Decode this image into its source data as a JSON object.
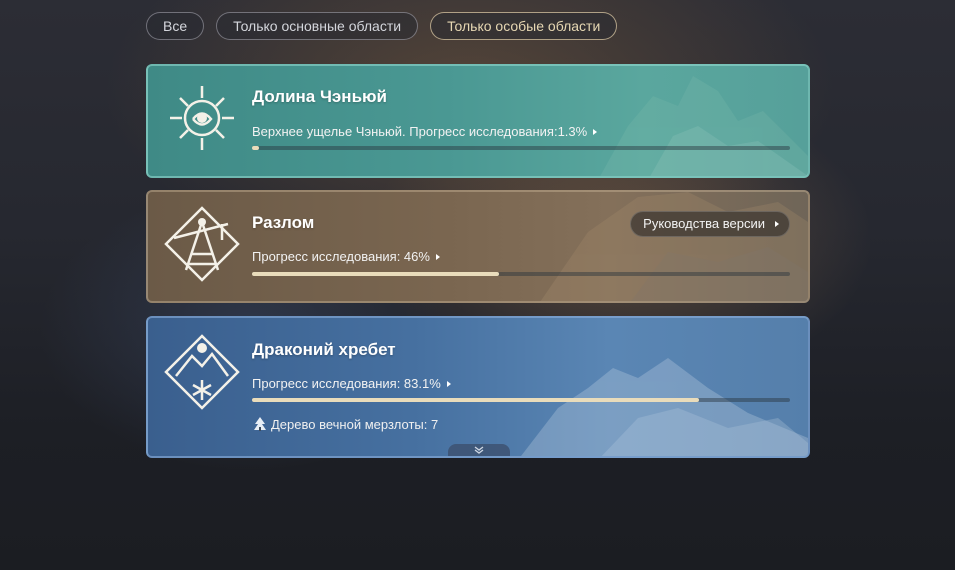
{
  "filters": [
    {
      "label": "Все",
      "active": false
    },
    {
      "label": "Только основные области",
      "active": false
    },
    {
      "label": "Только особые области",
      "active": true
    }
  ],
  "regions": [
    {
      "name": "Долина Чэньюй",
      "progress_label": "Верхнее ущелье Чэньюй. Прогресс исследования:1.3%",
      "progress": 1.3,
      "icon": "chenyu-vale-emblem-icon"
    },
    {
      "name": "Разлом",
      "progress_label": "Прогресс исследования: 46%",
      "progress": 46,
      "guide_button": "Руководства версии",
      "icon": "the-chasm-emblem-icon"
    },
    {
      "name": "Драконий хребет",
      "progress_label": "Прогресс исследования: 83.1%",
      "progress": 83.1,
      "extra": "Дерево вечной мерзлоты: 7",
      "icon": "dragonspine-emblem-icon"
    }
  ],
  "colors": {
    "bar_fill": "#e9dcbb",
    "active_filter": "#e6d7b3"
  }
}
